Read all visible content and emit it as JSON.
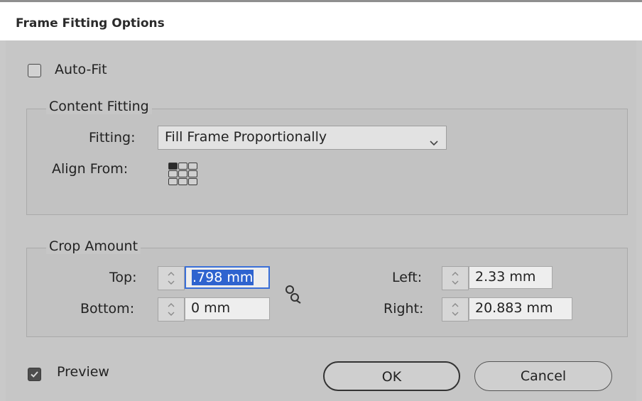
{
  "window": {
    "title": "Frame Fitting Options"
  },
  "auto_fit": {
    "label": "Auto-Fit",
    "checked": false
  },
  "content_fitting": {
    "group_title": "Content Fitting",
    "fitting_label": "Fitting:",
    "fitting_value": "Fill Frame Proportionally",
    "align_from_label": "Align From:",
    "align_from_selected": "top-left"
  },
  "crop_amount": {
    "group_title": "Crop Amount",
    "top_label": "Top:",
    "top_value": "798 mm",
    "top_value_prefix": ".",
    "bottom_label": "Bottom:",
    "bottom_value": "0 mm",
    "left_label": "Left:",
    "left_value": "2.33 mm",
    "right_label": "Right:",
    "right_value": "20.883 mm"
  },
  "preview": {
    "label": "Preview",
    "checked": true
  },
  "buttons": {
    "ok": "OK",
    "cancel": "Cancel"
  }
}
